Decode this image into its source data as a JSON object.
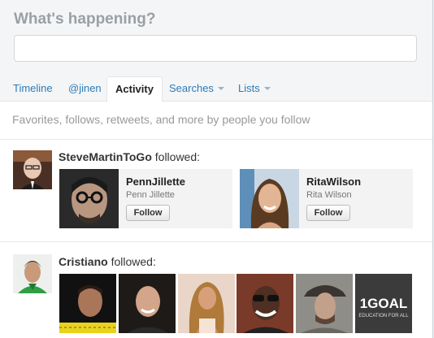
{
  "composer": {
    "title": "What's happening?",
    "placeholder": ""
  },
  "tabs": [
    {
      "label": "Timeline",
      "active": false
    },
    {
      "label": "@jinen",
      "active": false
    },
    {
      "label": "Activity",
      "active": true
    },
    {
      "label": "Searches",
      "dropdown": true
    },
    {
      "label": "Lists",
      "dropdown": true
    }
  ],
  "activity_description": "Favorites, follows, retweets, and more by people you follow",
  "events": [
    {
      "actor": "SteveMartinToGo",
      "action": "followed:",
      "followed": [
        {
          "name": "PennJillette",
          "screen_name": "Penn Jillette",
          "button": "Follow"
        },
        {
          "name": "RitaWilson",
          "screen_name": "Rita Wilson",
          "button": "Follow"
        }
      ]
    },
    {
      "actor": "Cristiano",
      "action": "followed:",
      "thumbnails": [
        {
          "icon": "man-portrait"
        },
        {
          "icon": "man-portrait"
        },
        {
          "icon": "woman-portrait"
        },
        {
          "icon": "man-sunglasses-portrait"
        },
        {
          "icon": "man-hat-portrait"
        },
        {
          "icon": "1goal-logo",
          "logo_text": "1GOAL",
          "logo_subtext": "EDUCATION FOR ALL"
        }
      ]
    }
  ],
  "colors": {
    "link": "#2b7bb9",
    "muted": "#999999",
    "header_bg": "#f4f5f6"
  }
}
